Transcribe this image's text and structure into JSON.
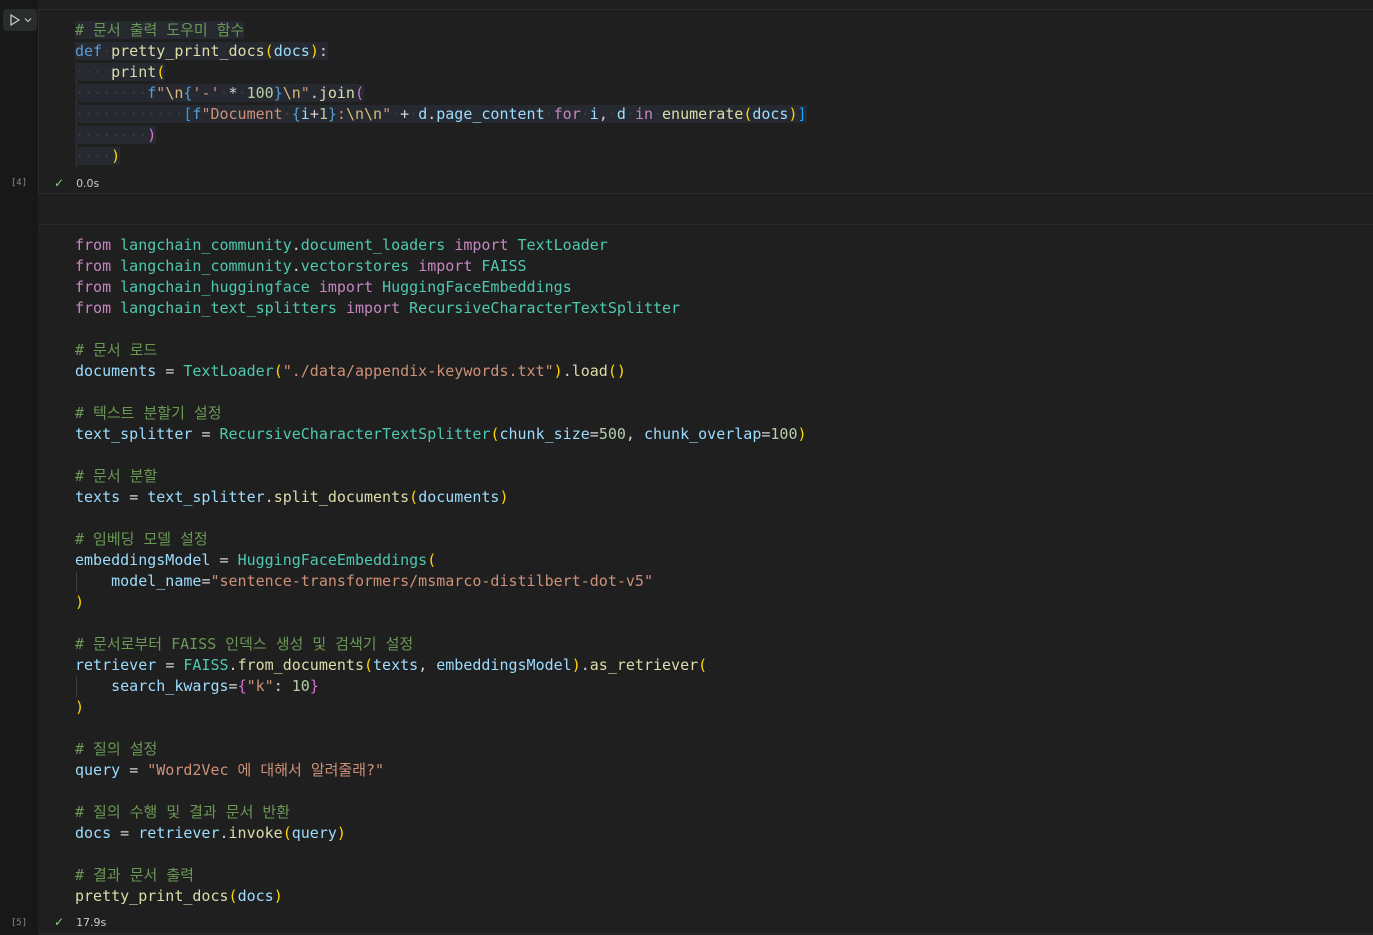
{
  "cells": [
    {
      "exec_count": "[4]",
      "duration": "0.0s",
      "status_icon": "check-icon",
      "lines": [
        "# 문서 출력 도우미 함수",
        "def pretty_print_docs(docs):",
        "    print(",
        "        f\"\\n{'-' * 100}\\n\".join(",
        "            [f\"Document {i+1}:\\n\\n\" + d.page_content for i, d in enumerate(docs)]",
        "        )",
        "    )"
      ]
    },
    {
      "exec_count": "[5]",
      "duration": "17.9s",
      "status_icon": "check-icon",
      "lines": [
        "from langchain_community.document_loaders import TextLoader",
        "from langchain_community.vectorstores import FAISS",
        "from langchain_huggingface import HuggingFaceEmbeddings",
        "from langchain_text_splitters import RecursiveCharacterTextSplitter",
        "",
        "# 문서 로드",
        "documents = TextLoader(\"./data/appendix-keywords.txt\").load()",
        "",
        "# 텍스트 분할기 설정",
        "text_splitter = RecursiveCharacterTextSplitter(chunk_size=500, chunk_overlap=100)",
        "",
        "# 문서 분할",
        "texts = text_splitter.split_documents(documents)",
        "",
        "# 임베딩 모델 설정",
        "embeddingsModel = HuggingFaceEmbeddings(",
        "    model_name=\"sentence-transformers/msmarco-distilbert-dot-v5\"",
        ")",
        "",
        "# 문서로부터 FAISS 인덱스 생성 및 검색기 설정",
        "retriever = FAISS.from_documents(texts, embeddingsModel).as_retriever(",
        "    search_kwargs={\"k\": 10}",
        ")",
        "",
        "# 질의 설정",
        "query = \"Word2Vec 에 대해서 알려줄래?\"",
        "",
        "# 질의 수행 및 결과 문서 반환",
        "docs = retriever.invoke(query)",
        "",
        "# 결과 문서 출력",
        "pretty_print_docs(docs)"
      ]
    }
  ],
  "toolbar": {
    "run_icon": "play-icon",
    "dropdown_icon": "chevron-down-icon"
  },
  "colors": {
    "background": "#1f1f1f",
    "keyword": "#569cd6",
    "control": "#c586c0",
    "function": "#dcdcaa",
    "class": "#4ec9b0",
    "variable": "#9cdcfe",
    "string": "#ce9178",
    "number": "#b5cea8",
    "comment": "#6a9955",
    "success": "#89d185"
  }
}
